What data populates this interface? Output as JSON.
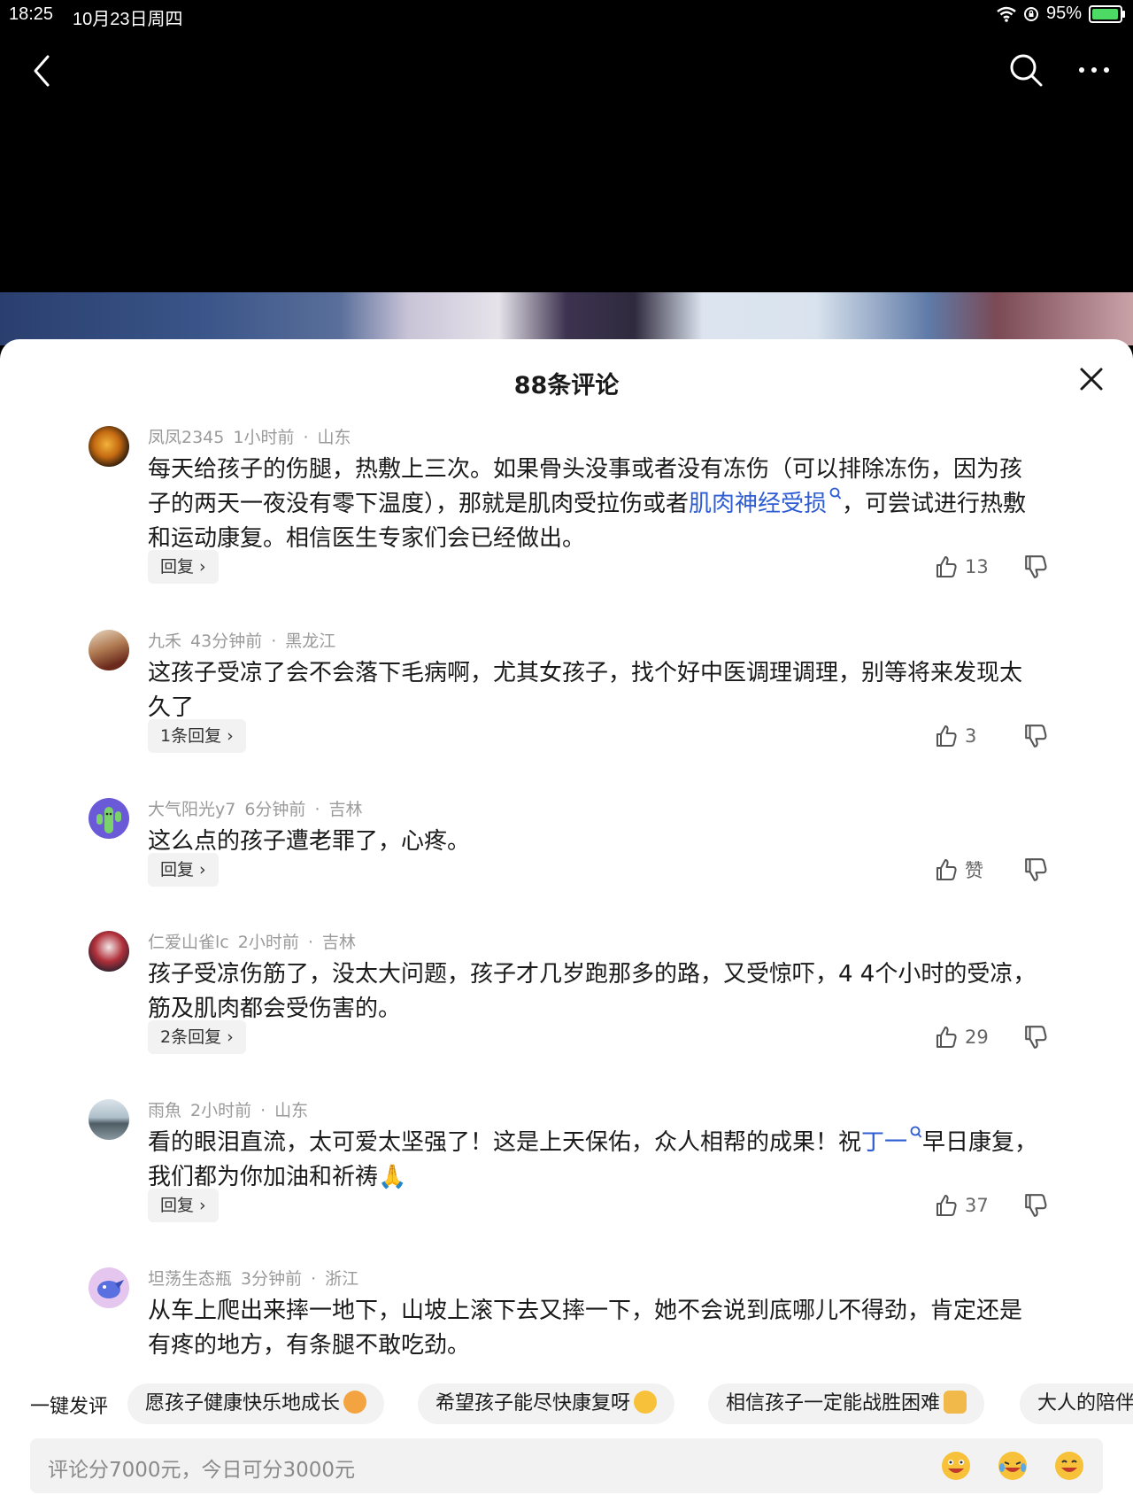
{
  "status_bar": {
    "time": "18:25",
    "date": "10月23日周四",
    "battery": "95%",
    "battery_level": 0.95
  },
  "top_nav": {
    "back_icon": "chevron-left-icon",
    "search_icon": "search-icon",
    "more_icon": "more-dots-icon"
  },
  "sheet": {
    "title": "88条评论",
    "close_icon": "close-icon"
  },
  "comments": [
    {
      "username": "凤凤2345",
      "time": "1小时前",
      "location": "山东",
      "text_before": "每天给孩子的伤腿，热敷上三次。如果骨头没事或者没有冻伤（可以排除冻伤，因为孩子的两天一夜没有零下温度），那就是肌肉受拉伤或者",
      "link": "肌肉神经受损",
      "text_after": "，可尝试进行热敷和运动康复。相信医生专家们会已经做出。",
      "reply_label": "回复",
      "likes": "13"
    },
    {
      "username": "九禾",
      "time": "43分钟前",
      "location": "黑龙江",
      "text": "这孩子受凉了会不会落下毛病啊，尤其女孩子，找个好中医调理调理，别等将来发现太久了",
      "reply_label": "1条回复",
      "likes": "3"
    },
    {
      "username": "大气阳光y7",
      "time": "6分钟前",
      "location": "吉林",
      "text": "这么点的孩子遭老罪了，心疼。",
      "reply_label": "回复",
      "likes": "赞"
    },
    {
      "username": "仁爱山雀lc",
      "time": "2小时前",
      "location": "吉林",
      "text": "孩子受凉伤筋了，没太大问题，孩子才几岁跑那多的路，又受惊吓，4 4个小时的受凉，筋及肌肉都会受伤害的。",
      "reply_label": "2条回复",
      "likes": "29"
    },
    {
      "username": "雨魚",
      "time": "2小时前",
      "location": "山东",
      "text_before": "看的眼泪直流，太可爱太坚强了！这是上天保佑，众人相帮的成果！祝",
      "link": "丁一",
      "text_after": "早日康复，我们都为你加油和祈祷🙏",
      "reply_label": "回复",
      "likes": "37"
    },
    {
      "username": "坦荡生态瓶",
      "time": "3分钟前",
      "location": "浙江",
      "text": "从车上爬出来摔一地下，山坡上滚下去又摔一下，她不会说到底哪儿不得劲，肯定还是有疼的地方，有条腿不敢吃劲。"
    }
  ],
  "quick_replies": {
    "label": "一键发评",
    "chips": [
      "愿孩子健康快乐地成长",
      "希望孩子能尽快康复呀",
      "相信孩子一定能战胜困难",
      "大人的陪伴"
    ]
  },
  "input": {
    "placeholder": "评论分7000元，今日可分3000元",
    "emoji_icons": [
      "grinning-face-icon",
      "laughing-tears-icon",
      "smiling-face-icon"
    ]
  },
  "colors": {
    "link": "#2d5cd3",
    "meta": "#9a9a9a",
    "chip_bg": "#f2f2f2",
    "battery": "#4cd964"
  }
}
